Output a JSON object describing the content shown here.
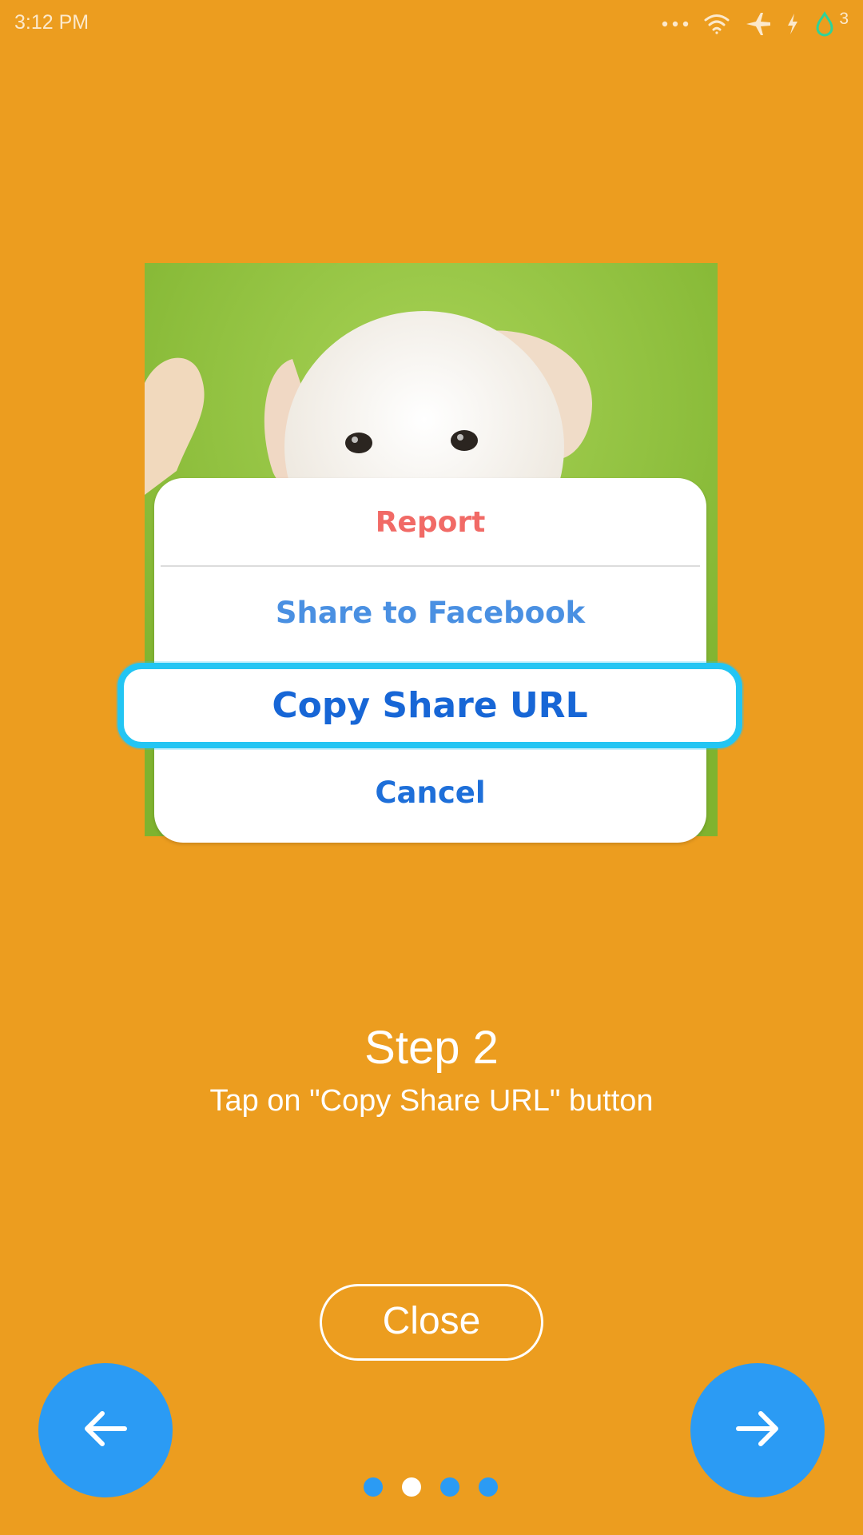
{
  "status_bar": {
    "time": "3:12 PM",
    "icons": [
      "more-dots-icon",
      "wifi-icon",
      "airplane-mode-icon",
      "charging-icon",
      "battery-drop-icon"
    ],
    "battery_level": "3"
  },
  "illustration": {
    "subject": "puppy-image"
  },
  "action_sheet": {
    "report_label": "Report",
    "facebook_label": "Share to Facebook",
    "copy_url_label": "Copy Share URL",
    "cancel_label": "Cancel"
  },
  "instructions": {
    "step_title": "Step 2",
    "step_description": "Tap on \"Copy Share URL\" button"
  },
  "controls": {
    "close_label": "Close",
    "prev_icon": "arrow-left-icon",
    "next_icon": "arrow-right-icon"
  },
  "pagination": {
    "total_pages": 4,
    "current_page": 2
  },
  "colors": {
    "background": "#EC9D1F",
    "accent_blue": "#2B9BF4",
    "highlight_border": "#23C5F3",
    "report_red": "#F16A66",
    "link_blue": "#4A90E2",
    "primary_blue": "#1766D6"
  }
}
